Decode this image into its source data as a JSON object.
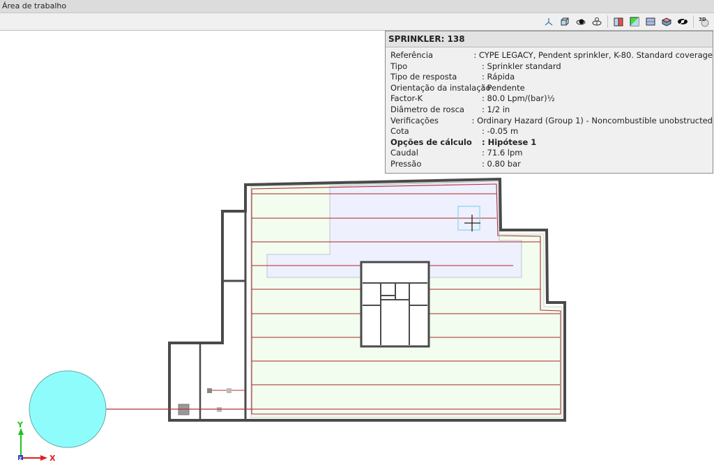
{
  "window": {
    "title": "Área de trabalho"
  },
  "toolbar": {
    "icons": [
      "axes-icon",
      "cube-view-icon",
      "orbit-view-icon",
      "rotate-view-icon",
      "section-red-icon",
      "section-green-icon",
      "plan-view-icon",
      "layers-icon",
      "hide-eye-icon",
      "3d-view-icon"
    ],
    "label_3d": "3D"
  },
  "info_panel": {
    "title": "SPRINKLER: 138",
    "rows": [
      {
        "key": "Referência",
        "value": ": CYPE LEGACY, Pendent sprinkler, K-80. Standard coverage"
      },
      {
        "key": "Tipo",
        "value": ": Sprinkler standard"
      },
      {
        "key": "Tipo de resposta",
        "value": ": Rápida"
      },
      {
        "key": "Orientação da instalação",
        "value": ": Pendente"
      },
      {
        "key": "Factor-K",
        "value": ": 80.0 Lpm/(bar)½"
      },
      {
        "key": "Diâmetro de rosca",
        "value": ": 1/2 in"
      },
      {
        "key": "Verificações",
        "value": ": Ordinary Hazard (Group 1) - Noncombustible unobstructed"
      },
      {
        "key": "Cota",
        "value": ": -0.05 m"
      },
      {
        "key": "Opções de cálculo",
        "value": ": Hipótese 1"
      },
      {
        "key": "Caudal",
        "value": ": 71.6 lpm"
      },
      {
        "key": "Pressão",
        "value": ": 0.80 bar"
      }
    ]
  },
  "axes": {
    "x": "X",
    "y": "Y",
    "z": "Z"
  },
  "colors": {
    "wall": "#4a4a4a",
    "pipe": "#b03030",
    "zone_green": "#f2fdf0",
    "zone_blue": "#eef0fd",
    "tank": "#8ffcfc",
    "selection": "#7fd6f0"
  }
}
